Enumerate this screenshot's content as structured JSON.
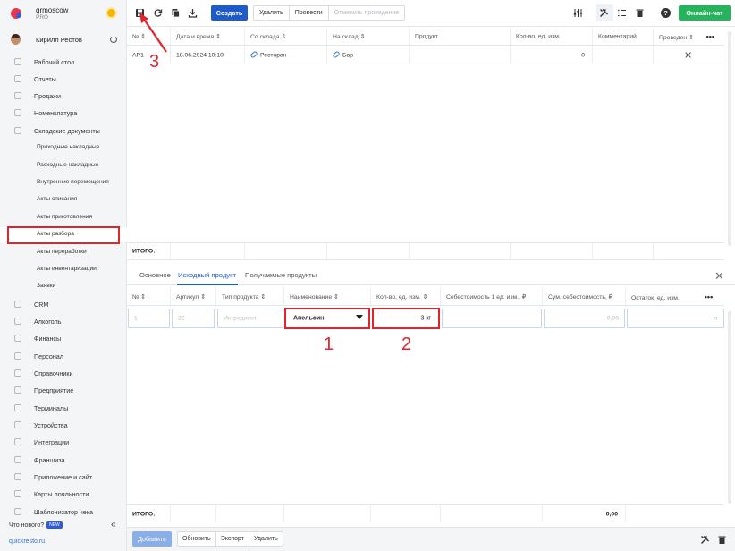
{
  "brand": {
    "name": "qrmoscow",
    "plan": "PRO"
  },
  "user": {
    "name": "Кирилл Рестов"
  },
  "nav": {
    "items": [
      {
        "label": "Рабочий стол",
        "icon": "desktop-icon"
      },
      {
        "label": "Отчеты",
        "icon": "reports-icon"
      },
      {
        "label": "Продажи",
        "icon": "sales-icon"
      },
      {
        "label": "Номенклатура",
        "icon": "nomenclature-icon"
      },
      {
        "label": "Складские документы",
        "icon": "warehouse-icon"
      }
    ],
    "subitems": [
      {
        "label": "Приходные накладные"
      },
      {
        "label": "Расходные накладные"
      },
      {
        "label": "Внутренние перемещения"
      },
      {
        "label": "Акты списания"
      },
      {
        "label": "Акты приготовления"
      },
      {
        "label": "Акты разбора"
      },
      {
        "label": "Акты переработки"
      },
      {
        "label": "Акты инвентаризации"
      },
      {
        "label": "Заявки"
      }
    ],
    "items2": [
      {
        "label": "CRM",
        "icon": "crm-icon"
      },
      {
        "label": "Алкоголь",
        "icon": "alcohol-icon"
      },
      {
        "label": "Финансы",
        "icon": "finance-icon"
      },
      {
        "label": "Персонал",
        "icon": "staff-icon"
      },
      {
        "label": "Справочники",
        "icon": "directory-icon"
      },
      {
        "label": "Предприятие",
        "icon": "enterprise-icon"
      },
      {
        "label": "Терминалы",
        "icon": "terminal-icon"
      },
      {
        "label": "Устройства",
        "icon": "device-icon"
      },
      {
        "label": "Интеграции",
        "icon": "integration-icon"
      },
      {
        "label": "Франшиза",
        "icon": "franchise-icon"
      },
      {
        "label": "Приложение и сайт",
        "icon": "app-icon"
      },
      {
        "label": "Карты лояльности",
        "icon": "loyalty-icon"
      },
      {
        "label": "Шаблонизатор чека",
        "icon": "receipt-icon"
      }
    ],
    "whats_new": "Что нового?",
    "new_badge": "NEW",
    "site": "quickresto.ru"
  },
  "toolbar": {
    "create": "Создать",
    "delete": "Удалить",
    "conduct": "Провести",
    "cancel_conduct": "Отменить проведение",
    "chat": "Онлайн-чат"
  },
  "main_table": {
    "headers": [
      "№",
      "Дата и время",
      "Со склада",
      "На склад",
      "Продукт",
      "Кол-во, ед. изм.",
      "Комментарий",
      "Проведен"
    ],
    "rows": [
      {
        "num": "АР1",
        "date": "18.06.2024 10:10",
        "from": "Ресторан",
        "to": "Бар",
        "product": "",
        "qty": "0",
        "comment": "",
        "conducted": "✕"
      }
    ],
    "total_label": "ИТОГО:"
  },
  "tabs": [
    "Основное",
    "Исходный продукт",
    "Получаемые продукты"
  ],
  "detail_table": {
    "headers": [
      "№",
      "Артикул",
      "Тип продукта",
      "Наименование",
      "Кол-во, ед. изм.",
      "Себестоимость 1 ед. изм., ₽",
      "Сум. себестоимость, ₽",
      "Остаток, ед. изм."
    ],
    "row": {
      "num": "1",
      "article": "22",
      "type": "Ингредиент",
      "name": "Апельсин",
      "qty": "3 кг",
      "unit_cost": "",
      "sum_cost": "0,00",
      "rest": "кг"
    },
    "total_label": "ИТОГО:",
    "total_sum": "0,00"
  },
  "annotations": [
    "1",
    "2",
    "3"
  ],
  "footer": {
    "add": "Добавить",
    "refresh": "Обновить",
    "export": "Экспорт",
    "delete": "Удалить"
  }
}
